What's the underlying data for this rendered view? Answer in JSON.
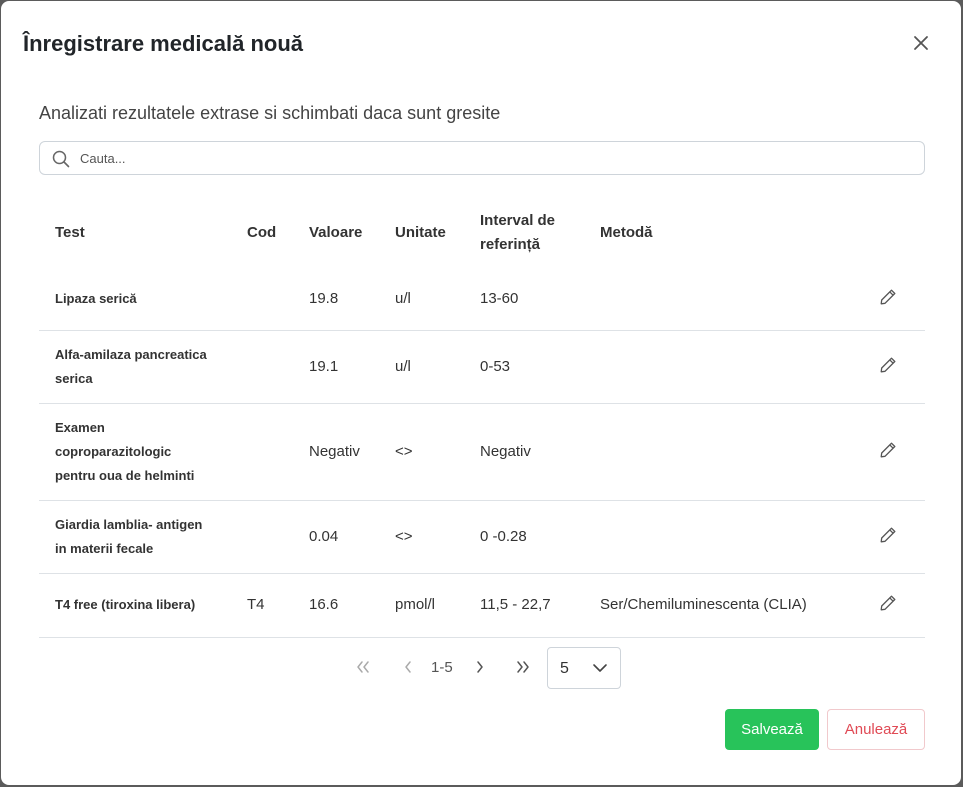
{
  "modal": {
    "title": "Înregistrare medicală nouă",
    "subtitle": "Analizati rezultatele extrase si schimbati daca sunt gresite"
  },
  "search": {
    "placeholder": "Cauta..."
  },
  "table": {
    "headers": {
      "test": "Test",
      "code": "Cod",
      "value": "Valoare",
      "unit": "Unitate",
      "reference": "Interval de referință",
      "method": "Metodă"
    },
    "rows": [
      {
        "test": "Lipaza serică",
        "code": "",
        "value": "19.8",
        "unit": "u/l",
        "reference": "13-60",
        "method": ""
      },
      {
        "test": "Alfa-amilaza pancreatica serica",
        "code": "",
        "value": "19.1",
        "unit": "u/l",
        "reference": "0-53",
        "method": ""
      },
      {
        "test": "Examen coproparazitologic pentru oua de helminti",
        "code": "",
        "value": "Negativ",
        "unit": "<>",
        "reference": "Negativ",
        "method": ""
      },
      {
        "test": "Giardia lamblia- antigen in materii fecale",
        "code": "",
        "value": "0.04",
        "unit": "<>",
        "reference": "0 -0.28",
        "method": ""
      },
      {
        "test": "T4 free (tiroxina libera)",
        "code": "T4",
        "value": "16.6",
        "unit": "pmol/l",
        "reference": "11,5 - 22,7",
        "method": "Ser/Chemiluminescenta (CLIA)"
      }
    ]
  },
  "pagination": {
    "range": "1-5",
    "page_size": "5"
  },
  "actions": {
    "save_label": "Salvează",
    "cancel_label": "Anulează"
  },
  "colors": {
    "save": "#28c35a",
    "cancel_text": "#e04a55",
    "cancel_border": "#f1c9cc"
  }
}
